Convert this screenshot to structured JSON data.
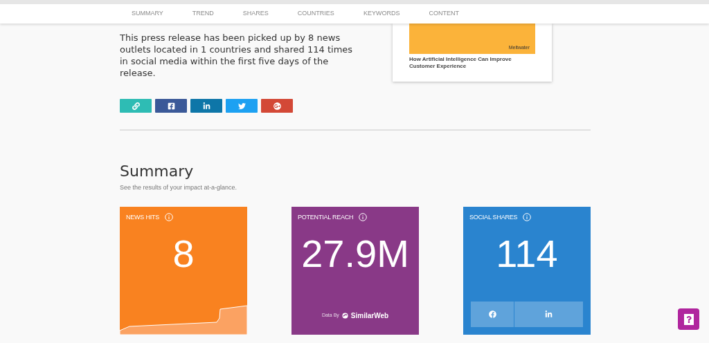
{
  "nav": {
    "tabs": [
      "SUMMARY",
      "TREND",
      "SHARES",
      "COUNTRIES",
      "KEYWORDS",
      "CONTENT"
    ]
  },
  "intro": "This press release has been picked up by 8 news outlets located in 1 countries and shared 114 times in social media within the first five days of the release.",
  "preview": {
    "brand": "Meltwater",
    "title": "How Artificial Intelligence Can Improve Customer Experience"
  },
  "share_buttons": [
    {
      "kind": "link",
      "color": "#2ebcb4"
    },
    {
      "kind": "facebook",
      "color": "#3b5998"
    },
    {
      "kind": "linkedin",
      "color": "#0e76a8"
    },
    {
      "kind": "twitter",
      "color": "#1da1f2"
    },
    {
      "kind": "googleplus",
      "color": "#d34836"
    }
  ],
  "summary": {
    "title": "Summary",
    "subtitle": "See the results of your impact at-a-glance."
  },
  "cards": [
    {
      "kind": "news_hits",
      "label": "NEWS HITS",
      "value": "8",
      "color": "#f98220"
    },
    {
      "kind": "reach",
      "label": "POTENTIAL REACH",
      "value": "27.9M",
      "color": "#893987",
      "credit_prefix": "Data By",
      "credit": "SimilarWeb"
    },
    {
      "kind": "social",
      "label": "SOCIAL SHARES",
      "value": "114",
      "color": "#2a84cf",
      "buttons": [
        {
          "kind": "facebook"
        },
        {
          "kind": "linkedin"
        }
      ]
    }
  ]
}
